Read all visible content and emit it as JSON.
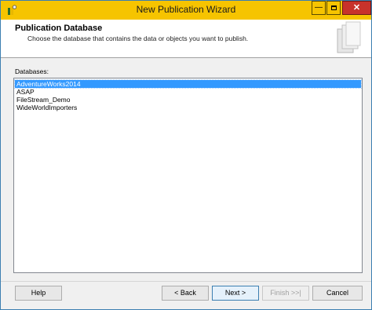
{
  "window": {
    "title": "New Publication Wizard",
    "icons": {
      "app": "key-user-icon",
      "minimize": "minimize-icon",
      "maximize": "maximize-icon",
      "close": "close-icon"
    }
  },
  "header": {
    "title": "Publication Database",
    "subtitle": "Choose the database that contains the data or objects you want to publish.",
    "graphic_icon": "database-stack-icon"
  },
  "databases": {
    "label": "Databases:",
    "items": [
      "AdventureWorks2014",
      "ASAP",
      "FileStream_Demo",
      "WideWorldImporters"
    ],
    "selected": "AdventureWorks2014"
  },
  "buttons": {
    "help": "Help",
    "back": "< Back",
    "next": "Next >",
    "finish": "Finish >>|",
    "cancel": "Cancel"
  },
  "colors": {
    "titlebar": "#f6c400",
    "close_button": "#c8322b",
    "selection": "#3399ff"
  }
}
